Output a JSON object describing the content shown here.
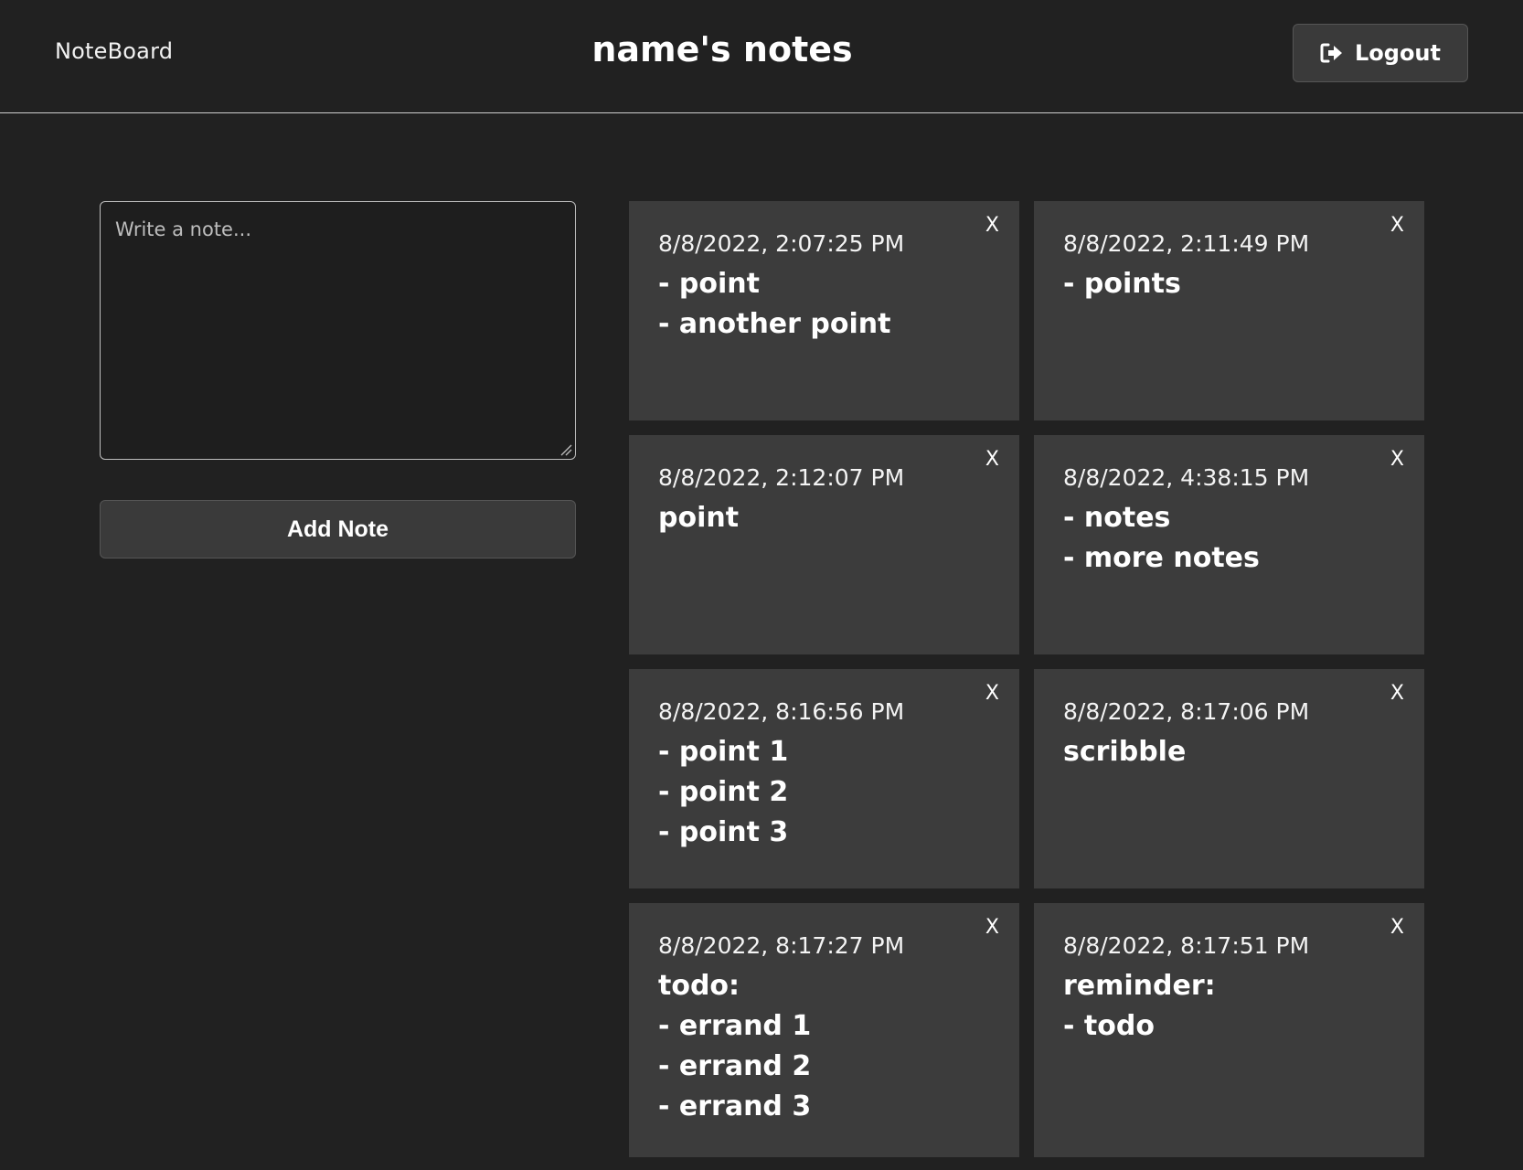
{
  "header": {
    "brand": "NoteBoard",
    "title": "name's notes",
    "logout_label": "Logout",
    "logout_icon": "logout-icon"
  },
  "composer": {
    "placeholder": "Write a note...",
    "value": "",
    "add_label": "Add Note"
  },
  "notes": [
    {
      "date": "8/8/2022, 2:07:25 PM",
      "body": "- point\n- another point",
      "close": "X"
    },
    {
      "date": "8/8/2022, 2:11:49 PM",
      "body": "- points",
      "close": "X"
    },
    {
      "date": "8/8/2022, 2:12:07 PM",
      "body": "point",
      "close": "X"
    },
    {
      "date": "8/8/2022, 4:38:15 PM",
      "body": "- notes\n- more notes",
      "close": "X"
    },
    {
      "date": "8/8/2022, 8:16:56 PM",
      "body": "- point 1\n- point 2\n- point 3",
      "close": "X"
    },
    {
      "date": "8/8/2022, 8:17:06 PM",
      "body": "scribble",
      "close": "X"
    },
    {
      "date": "8/8/2022, 8:17:27 PM",
      "body": "todo:\n- errand 1\n- errand 2\n- errand 3",
      "close": "X"
    },
    {
      "date": "8/8/2022, 8:17:51 PM",
      "body": "reminder:\n- todo",
      "close": "X"
    }
  ],
  "colors": {
    "background": "#212121",
    "card": "#3c3c3c",
    "button": "#3a3a3a",
    "text": "#ffffff"
  }
}
